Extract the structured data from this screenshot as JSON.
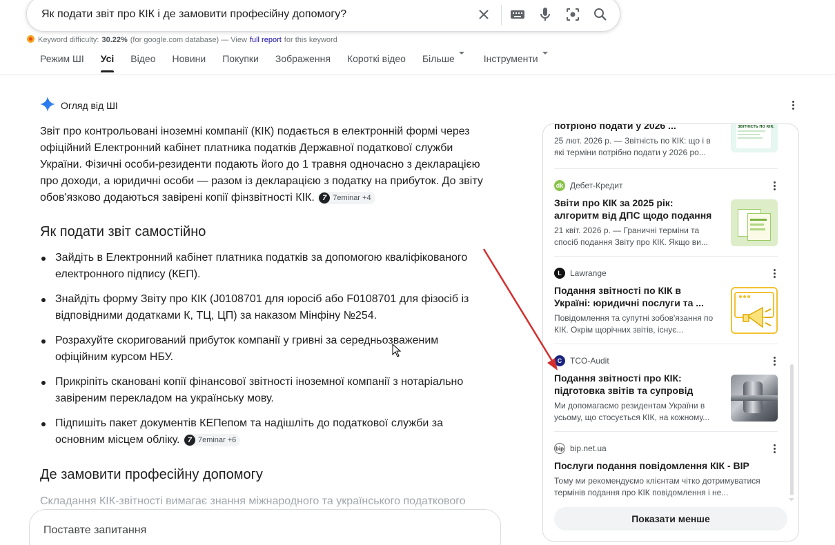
{
  "search": {
    "query": "Як подати звіт про КІК і де замовити професійну допомогу?"
  },
  "keyword": {
    "label": "Keyword difficulty:",
    "value": "30.22%",
    "db": "(for google.com database) — View",
    "link": "full report",
    "suffix": "for this keyword"
  },
  "tabs": [
    {
      "label": "Режим ШІ"
    },
    {
      "label": "Усі"
    },
    {
      "label": "Відео"
    },
    {
      "label": "Новини"
    },
    {
      "label": "Покупки"
    },
    {
      "label": "Зображення"
    },
    {
      "label": "Короткі відео"
    },
    {
      "label": "Більше"
    },
    {
      "label": "Інструменти"
    }
  ],
  "ai": {
    "heading": "Огляд від ШІ",
    "intro": "Звіт про контрольовані іноземні компанії (КІК) подається в електронній формі через офіційний Електронний кабінет платника податків Державної податкової служби України. Фізичні особи-резиденти подають його до 1 травня одночасно з декларацією про доходи, а юридичні особи — разом із декларацією з податку на прибуток. До звіту обов'язково додаються завірені копії фінзвітності КІК.",
    "intro_chip": "7eminar +4",
    "section1": "Як подати звіт самостійно",
    "steps": [
      "Зайдіть в Електронний кабінет платника податків за допомогою кваліфікованого електронного підпису (КЕП).",
      "Знайдіть форму Звіту про КІК (J0108701 для юросіб або F0108701 для фізосіб із відповідними додатками К, ТЦ, ЦП) за наказом Мінфіну №254.",
      "Розрахуйте скоригований прибуток компанії у гривні за середньозваженим офіційним курсом НБУ.",
      "Прикріпіть скановані копії фінансової звітності іноземної компанії з нотаріально завіреним перекладом на українську мову.",
      "Підпишіть пакет документів КЕПепом та надішліть до податкової служби за основним місцем обліку."
    ],
    "steps_chip": "7eminar +6",
    "section2": "Де замовити професійну допомогу",
    "faded": "Складання КІК-звітності вимагає знання міжнародного та українського податкового",
    "ask_placeholder": "Поставте запитання"
  },
  "sources": [
    {
      "site": "",
      "title": "потрібно подати у 2026 ...",
      "snippet": "25 лют. 2026 р. — Звітність по КІК: що і в які терміни потрібно подати у 2026 ро..."
    },
    {
      "site": "Дебет-Кредит",
      "title": "Звіти про КІК за 2025 рік: алгоритм від ДПС щодо подання",
      "snippet": "21 квіт. 2026 р. — Граничні терміни та спосіб подання Звіту про КІК. Якщо ви..."
    },
    {
      "site": "Lawrange",
      "title": "Подання звітності по КІК в Україні: юридичні послуги та ...",
      "snippet": "Повідомлення та супутні зобов'язання по КІК. Окрім щорічних звітів, існує..."
    },
    {
      "site": "TCO-Audit",
      "title": "Подання звітності про КІК: підготовка звітів та супровід",
      "snippet": "Ми допомагаємо резидентам України в усьому, що стосується КІК, на кожному..."
    },
    {
      "site": "bip.net.ua",
      "title": "Послуги подання повідомлення КІК - BIP",
      "snippet": "Тому ми рекомендуємо клієнтам чітко дотримуватися термінів подання про КІК повідомлення і не..."
    }
  ],
  "show_less": "Показати менше",
  "thumb_text": "ЗВІТНІСТЬ ПО КІК:",
  "colors": {
    "arrow": "#d32f2f",
    "link": "#1a0dab",
    "gemini_blue": "#4285f4"
  }
}
